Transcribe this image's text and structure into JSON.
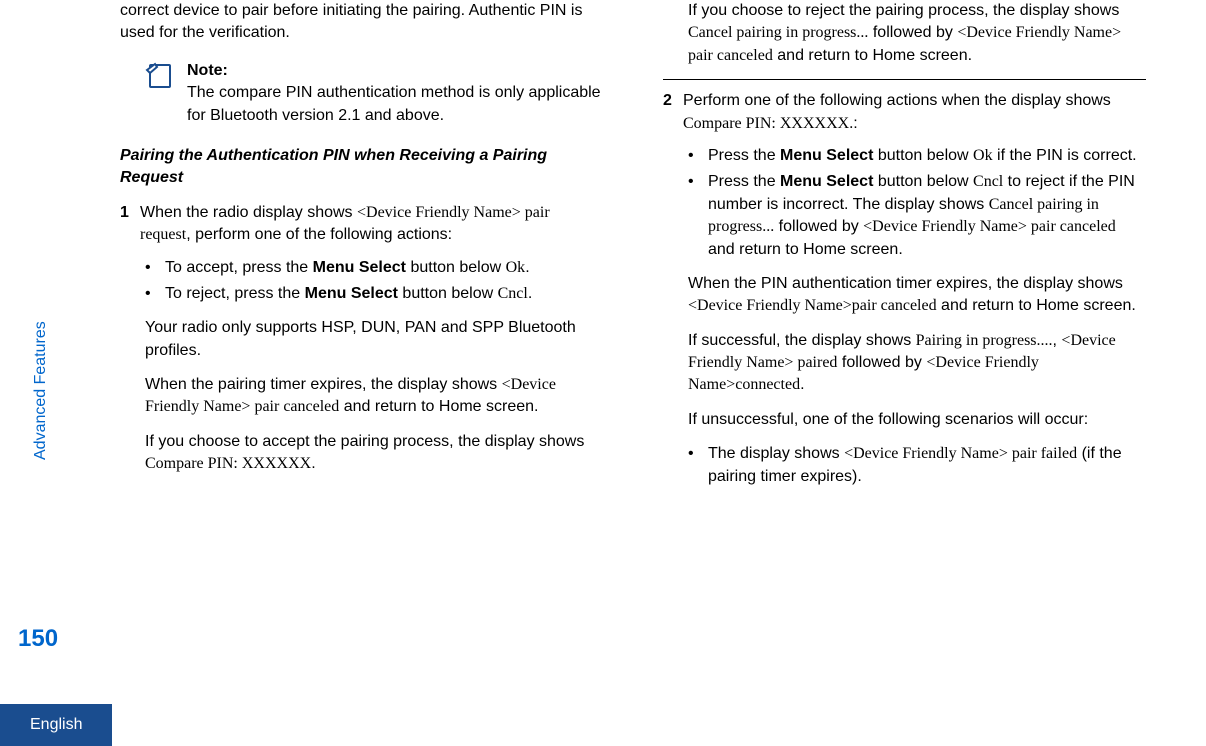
{
  "sidebar": {
    "section_label": "Advanced Features",
    "page_number": "150",
    "language": "English"
  },
  "left": {
    "intro_para": "correct device to pair before initiating the pairing. Authentic PIN is used for the verification.",
    "note_label": "Note:",
    "note_body": "The compare PIN authentication method is only applicable for Bluetooth version 2.1 and above.",
    "heading": "Pairing the Authentication PIN when Receiving a Pairing Request",
    "step1_num": "1",
    "step1_a": "When the radio display shows ",
    "step1_display": "<Device Friendly Name> pair request",
    "step1_b": ", perform one of the following actions:",
    "bullet1_a": "To accept, press the ",
    "bullet1_bold": "Menu Select",
    "bullet1_b": " button below ",
    "bullet1_serif": "Ok",
    "bullet1_c": ".",
    "bullet2_a": "To reject, press the ",
    "bullet2_bold": "Menu Select",
    "bullet2_b": " button below ",
    "bullet2_serif": "Cncl",
    "bullet2_c": ".",
    "para2": "Your radio only supports HSP, DUN, PAN and SPP Bluetooth profiles.",
    "para3_a": "When the pairing timer expires, the display shows ",
    "para3_display": "<Device Friendly Name> pair canceled",
    "para3_b": " and return to Home screen.",
    "para4_a": "If you choose to accept the pairing process, the display shows ",
    "para4_display": "Compare PIN: XXXXXX",
    "para4_b": "."
  },
  "right": {
    "para1_a": "If you choose to reject the pairing process, the display shows ",
    "para1_s1": "Cancel pairing in progress...",
    "para1_b": " followed by ",
    "para1_s2": "<Device Friendly Name> pair canceled",
    "para1_c": " and return to Home screen.",
    "step2_num": "2",
    "step2_a": "Perform one of the following actions when the display shows ",
    "step2_serif": "Compare PIN: XXXXXX.",
    "step2_b": ":",
    "bullet1_a": "Press the ",
    "bullet1_bold": "Menu Select",
    "bullet1_b": " button below ",
    "bullet1_serif": "Ok",
    "bullet1_c": " if the PIN is correct.",
    "bullet2_a": "Press the ",
    "bullet2_bold": "Menu Select",
    "bullet2_b": " button below ",
    "bullet2_serif": "Cncl",
    "bullet2_c": " to reject if the PIN number is incorrect. The display shows ",
    "bullet2_s2": "Cancel pairing in progress...",
    "bullet2_d": " followed by ",
    "bullet2_s3": "<Device Friendly Name> pair canceled",
    "bullet2_e": " and return to Home screen.",
    "para2_a": "When the PIN authentication timer expires, the display shows ",
    "para2_serif": "<Device Friendly Name>pair canceled",
    "para2_b": " and return to Home screen.",
    "para3_a": "If successful, the display shows ",
    "para3_s1": "Pairing in progress....",
    "para3_b": ", ",
    "para3_s2": "<Device Friendly Name> paired",
    "para3_c": " followed by ",
    "para3_s3": "<Device Friendly Name>connected",
    "para3_d": ".",
    "para4": "If unsuccessful, one of the following scenarios will occur:",
    "bullet3_a": "The display shows ",
    "bullet3_serif": "<Device Friendly Name> pair failed",
    "bullet3_b": " (if the pairing timer expires)."
  }
}
